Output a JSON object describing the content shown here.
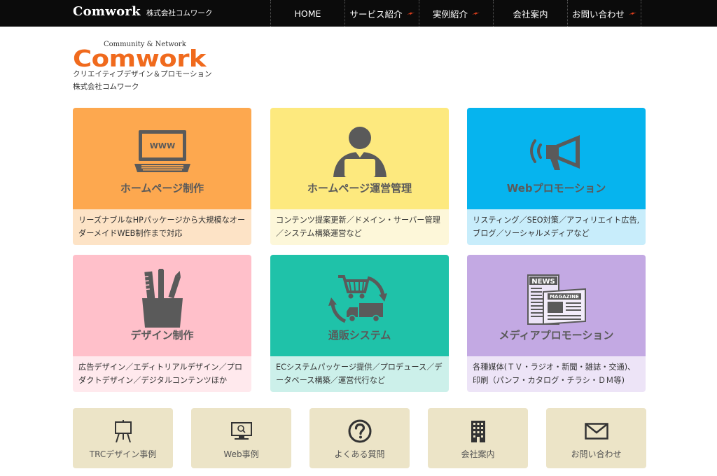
{
  "header": {
    "brand_name": "Comwork",
    "brand_sub": "株式会社コムワーク",
    "nav": [
      {
        "label": "HOME",
        "arrow": false
      },
      {
        "label": "サービス紹介",
        "arrow": true
      },
      {
        "label": "実例紹介",
        "arrow": true
      },
      {
        "label": "会社案内",
        "arrow": false
      },
      {
        "label": "お問い合わせ",
        "arrow": true
      }
    ]
  },
  "logo": {
    "tagline": "Community & Network",
    "wordmark": "Comwork",
    "line1": "クリエイティブデザイン＆プロモーション",
    "line2": "株式会社コムワーク"
  },
  "services": [
    {
      "title": "ホームページ制作",
      "desc": "リーズナブルなHPパッケージから大規模なオーダーメイドWEB制作まで対応",
      "icon": "laptop-www-icon",
      "top_color": "#fda84f",
      "bottom_color": "#fde3c6",
      "screen_text": "WWW"
    },
    {
      "title": "ホームページ運営管理",
      "desc": "コンテンツ提案更新／ドメイン・サーバー管理／システム構築運営など",
      "icon": "person-laptop-icon",
      "top_color": "#fde97e",
      "bottom_color": "#fdf7d9"
    },
    {
      "title": "Webプロモーション",
      "desc": "リスティング／SEO対策／アフィリエイト広告,ブログ／ソーシャルメディアなど",
      "icon": "megaphone-icon",
      "top_color": "#06b4ee",
      "bottom_color": "#c8edfb"
    },
    {
      "title": "デザイン制作",
      "desc": "広告デザイン／エディトリアルデザイン／プロダクトデザイン／デジタルコンテンツほか",
      "icon": "pen-cup-icon",
      "top_color": "#ffc0ca",
      "bottom_color": "#ffe9ed"
    },
    {
      "title": "通販システム",
      "desc": "ECシステムパッケージ提供／プロデュース／データベース構築／運営代行など",
      "icon": "cart-truck-icon",
      "top_color": "#1fc2a9",
      "bottom_color": "#ccf0ea"
    },
    {
      "title": "メディアプロモーション",
      "desc": "各種媒体(ＴＶ・ラジオ・新聞・雑誌・交通)、印刷（パンフ・カタログ・チラシ・ＤＭ等)",
      "icon": "newspaper-icon",
      "top_color": "#c3a9e3",
      "bottom_color": "#ede4f7",
      "news_text": "NEWS",
      "magazine_text": "MAGAZINE"
    }
  ],
  "tiles": [
    {
      "label": "TRCデザイン事例",
      "icon": "easel-icon"
    },
    {
      "label": "Web事例",
      "icon": "monitor-search-icon"
    },
    {
      "label": "よくある質問",
      "icon": "question-circle-icon"
    },
    {
      "label": "会社案内",
      "icon": "building-icon"
    },
    {
      "label": "お問い合わせ",
      "icon": "envelope-icon"
    }
  ],
  "colors": {
    "topbar": "#0b0b0b",
    "logo_orange": "#f06a1d",
    "icon_gray": "#5a5a5a",
    "tile_bg": "#ece4c7",
    "nav_arrow": "#e8401c"
  }
}
